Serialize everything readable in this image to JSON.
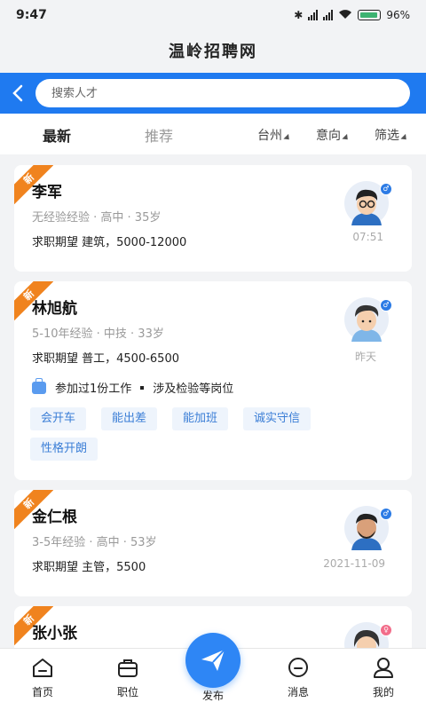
{
  "status": {
    "time": "9:47",
    "battery": "96%"
  },
  "app": {
    "title": "温岭招聘网"
  },
  "search": {
    "placeholder": "搜索人才"
  },
  "tabs": [
    {
      "label": "最新",
      "active": true
    },
    {
      "label": "推荐",
      "active": false
    }
  ],
  "filters": [
    {
      "label": "台州"
    },
    {
      "label": "意向"
    },
    {
      "label": "筛选"
    }
  ],
  "candidates": [
    {
      "badge": "新",
      "name": "李军",
      "meta": "无经验经验 · 高中 · 35岁",
      "expect": "求职期望 建筑，5000-12000",
      "time": "07:51",
      "gender": "male"
    },
    {
      "badge": "新",
      "name": "林旭航",
      "meta": "5-10年经验 · 中技 · 33岁",
      "expect": "求职期望 普工，4500-6500",
      "time": "昨天",
      "gender": "male",
      "experience": {
        "jobs": "参加过1份工作",
        "positions": "涉及检验等岗位"
      },
      "tags": [
        "会开车",
        "能出差",
        "能加班",
        "诚实守信",
        "性格开朗"
      ]
    },
    {
      "badge": "新",
      "name": "金仁根",
      "meta": "3-5年经验 · 高中 · 53岁",
      "expect": "求职期望 主管，5500",
      "time": "2021-11-09",
      "gender": "male"
    },
    {
      "badge": "新",
      "name": "张小张",
      "gender": "female"
    }
  ],
  "nav": [
    {
      "label": "首页",
      "icon": "home-icon"
    },
    {
      "label": "职位",
      "icon": "briefcase-icon"
    },
    {
      "label": "发布",
      "icon": "paper-plane-icon"
    },
    {
      "label": "消息",
      "icon": "message-icon"
    },
    {
      "label": "我的",
      "icon": "user-icon"
    }
  ],
  "colors": {
    "primary": "#1f7af0",
    "badge": "#f0831e",
    "tag_bg": "#eef4fc",
    "tag_text": "#3b7ed6"
  }
}
